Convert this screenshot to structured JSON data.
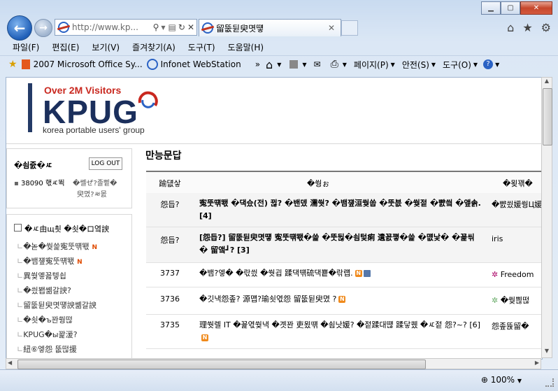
{
  "browser": {
    "address": "http://www.kp...",
    "tab_title": "留뚮뒫臾몃떟",
    "menu": [
      "파일(F)",
      "편집(E)",
      "보기(V)",
      "즐겨찾기(A)",
      "도구(T)",
      "도움말(H)"
    ],
    "favorites": [
      "2007 Microsoft Office Sy...",
      "Infonet WebStation"
    ],
    "command_menu": [
      "페이지(P)",
      "안전(S)",
      "도구(O)"
    ],
    "zoom": "100%",
    "more": "»"
  },
  "site": {
    "visitors": "Over 2M Visitors",
    "logo": "KPUG",
    "subtitle": "korea portable users' group"
  },
  "sidebar": {
    "user_name": "�쇰줈�ㅼ",
    "logout": "LOG OUT",
    "points": "38090 핷ㅼ뙥",
    "links": [
      "�쎌ぜ?졸삩�",
      "臾몄?ㅽ몴"
    ],
    "menu_title": "�ㅼ由щ쵯 �쇳�ロ옄諛",
    "items": [
      {
        "label": "�녿�쒖쓽寃뚯떆뙋",
        "new": true
      },
      {
        "label": "�뱀쟾寃뚯떆뙋",
        "new": true
      },
      {
        "label": "異쒖옣꾧텧쇱",
        "new": false
      },
      {
        "label": "�씠봽쏆갈諛?",
        "new": false
      },
      {
        "label": "留뚮뒫臾몃떟諛쏆갈諛",
        "new": false
      },
      {
        "label": "�쇳�ъ꽌쒕떦",
        "new": false
      },
      {
        "label": "KPUG�ы꽕湲?",
        "new": false
      },
      {
        "label": "紐⑥엫怨 뚮떦援",
        "new": false
      }
    ]
  },
  "board": {
    "title": "만능문답",
    "headers": {
      "num": "踰덊샇",
      "title": "�쒕ぉ",
      "author": "�묒꽦�"
    },
    "rows": [
      {
        "num": "怨듭?",
        "title": "寃뚯떆뙋 �댁슜(전) 뀒?  �밴뎄 濡쒓?  �뱀쟾洹쒖쑵 �뚯븞 �쒖젙 �뺤씤 �앺솕. [4]",
        "author": "�뺤쑀媛쒕Ц媛",
        "badges": "",
        "hl": true
      },
      {
        "num": "怨듭?",
        "title": "[怨듭?] 留뚮뒫臾몃떟 寃뚯떆뙋�쓽 �뚯뒪�쇰텇痢 遺꾨쪟�쓽 �먮낯�  �꾩씪�  留앸┛? [3]",
        "author": "iris",
        "badges": "",
        "hl": true
      },
      {
        "num": "3737",
        "title": "�뱀?엫� �띿씠 �쒓굅 蹂댁떆硫댁뿉�띾럡.",
        "author": "Freedom",
        "badges": "N D",
        "hl": false
      },
      {
        "num": "3736",
        "title": "�깃낵怨좊? 源먭?瑜쇳엯怨 留뚮뒫臾몄 ?",
        "author": "�쒖쁺떦",
        "badges": "N",
        "hl": false
      },
      {
        "num": "3735",
        "title": "理쒓렐 IT �꾩엯쒖낵 �곗꽌 吏묐떆 �쇰낫媛?  �젙蹂대떊 蹂닿퀬 �ㅼ젙 怨?~? [6]",
        "author": "怨좊뜑留�",
        "badges": "N",
        "hl": false
      }
    ]
  },
  "colors": {
    "accent": "#1b2f5c",
    "new_badge": "#f08a1c",
    "visitors": "#c9281f"
  }
}
